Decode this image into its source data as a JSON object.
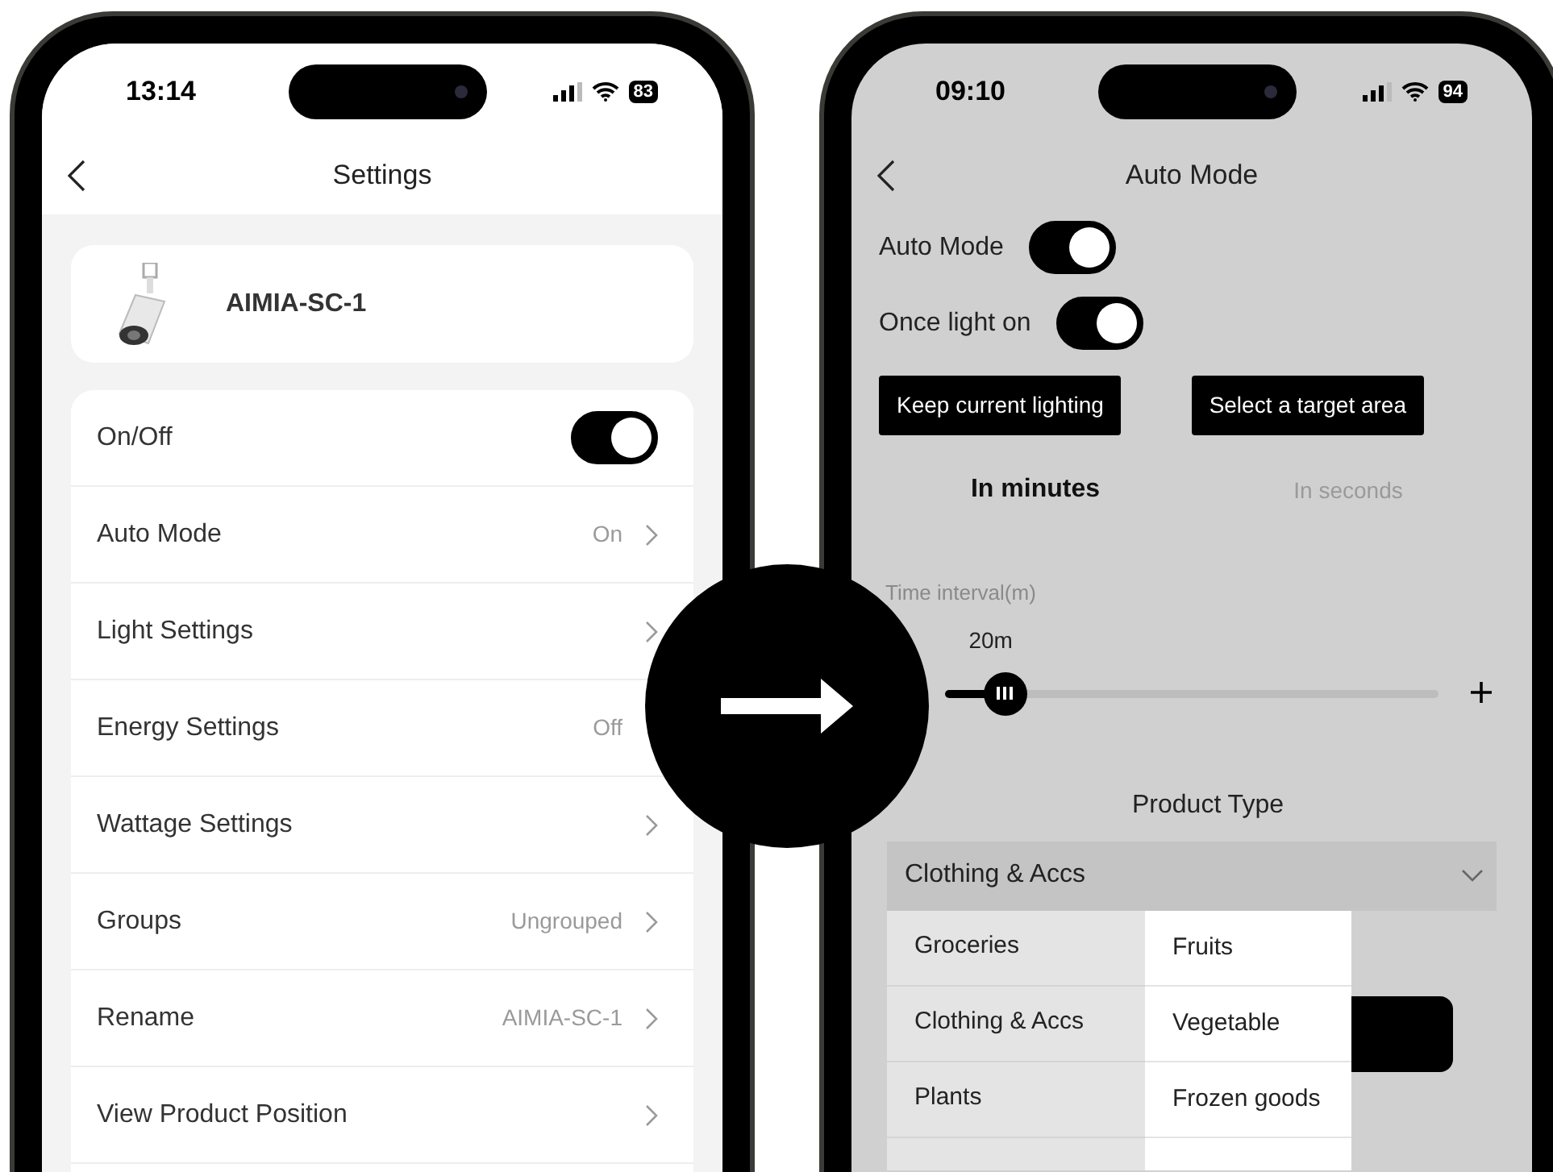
{
  "left_screen": {
    "status_bar": {
      "time": "13:14",
      "battery": "83"
    },
    "header": {
      "title": "Settings"
    },
    "device": {
      "name": "AIMIA-SC-1"
    },
    "settings": [
      {
        "kind": "toggle",
        "label": "On/Off",
        "on": true
      },
      {
        "kind": "link",
        "label": "Auto Mode",
        "value": "On"
      },
      {
        "kind": "link",
        "label": "Light Settings"
      },
      {
        "kind": "link",
        "label": "Energy Settings",
        "value": "Off",
        "chevron": false
      },
      {
        "kind": "link",
        "label": "Wattage Settings"
      },
      {
        "kind": "link",
        "label": "Groups",
        "value": "Ungrouped"
      },
      {
        "kind": "link",
        "label": "Rename",
        "value": "AIMIA-SC-1"
      },
      {
        "kind": "link",
        "label": "View Product Position"
      }
    ]
  },
  "right_screen": {
    "status_bar": {
      "time": "09:10",
      "battery": "94"
    },
    "header": {
      "title": "Auto Mode"
    },
    "toggles": [
      {
        "label": "Auto Mode",
        "on": true
      },
      {
        "label": "Once light on",
        "on": true
      }
    ],
    "buttons": [
      "Keep current lighting",
      "Select a target area"
    ],
    "tabs": [
      {
        "label": "In minutes",
        "selected": true
      },
      {
        "label": "In seconds",
        "selected": false
      }
    ],
    "time_interval": {
      "label": "Time interval(m)",
      "value": "20m",
      "level": 0.12
    },
    "product_type": {
      "label": "Product Type",
      "value": "Clothing & Accs"
    },
    "menu": {
      "categories": [
        "Groceries",
        "Clothing & Accs",
        "Plants"
      ],
      "subcategories": [
        "Fruits",
        "Vegetable",
        "Frozen goods"
      ]
    }
  }
}
